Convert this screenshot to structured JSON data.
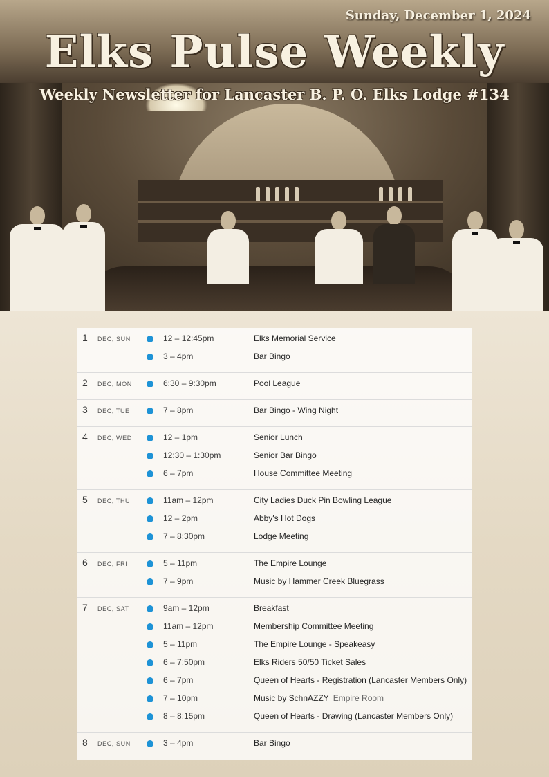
{
  "header": {
    "date": "Sunday, December 1, 2024",
    "title": "Elks Pulse Weekly",
    "subtitle": "Weekly Newsletter for Lancaster B. P. O. Elks Lodge #134"
  },
  "colors": {
    "event_dot": "#1e93d6"
  },
  "days": [
    {
      "num": "1",
      "label": "DEC, SUN",
      "events": [
        {
          "time": "12 – 12:45pm",
          "title": "Elks Memorial Service"
        },
        {
          "time": "3 – 4pm",
          "title": "Bar Bingo"
        }
      ]
    },
    {
      "num": "2",
      "label": "DEC, MON",
      "events": [
        {
          "time": "6:30 – 9:30pm",
          "title": "Pool League"
        }
      ]
    },
    {
      "num": "3",
      "label": "DEC, TUE",
      "events": [
        {
          "time": "7 – 8pm",
          "title": "Bar Bingo - Wing Night"
        }
      ]
    },
    {
      "num": "4",
      "label": "DEC, WED",
      "events": [
        {
          "time": "12 – 1pm",
          "title": "Senior Lunch"
        },
        {
          "time": "12:30 – 1:30pm",
          "title": "Senior Bar Bingo"
        },
        {
          "time": "6 – 7pm",
          "title": "House Committee Meeting"
        }
      ]
    },
    {
      "num": "5",
      "label": "DEC, THU",
      "events": [
        {
          "time": "11am – 12pm",
          "title": "City Ladies Duck Pin Bowling League"
        },
        {
          "time": "12 – 2pm",
          "title": "Abby's Hot Dogs"
        },
        {
          "time": "7 – 8:30pm",
          "title": "Lodge Meeting"
        }
      ]
    },
    {
      "num": "6",
      "label": "DEC, FRI",
      "events": [
        {
          "time": "5 – 11pm",
          "title": "The Empire Lounge"
        },
        {
          "time": "7 – 9pm",
          "title": "Music by Hammer Creek Bluegrass"
        }
      ]
    },
    {
      "num": "7",
      "label": "DEC, SAT",
      "events": [
        {
          "time": "9am – 12pm",
          "title": "Breakfast"
        },
        {
          "time": "11am – 12pm",
          "title": "Membership Committee Meeting"
        },
        {
          "time": "5 – 11pm",
          "title": "The Empire Lounge - Speakeasy"
        },
        {
          "time": "6 – 7:50pm",
          "title": "Elks Riders 50/50 Ticket Sales"
        },
        {
          "time": "6 – 7pm",
          "title": "Queen of Hearts - Registration (Lancaster Members Only)"
        },
        {
          "time": "7 – 10pm",
          "title": "Music by SchnAZZY",
          "location": "Empire Room"
        },
        {
          "time": "8 – 8:15pm",
          "title": "Queen of Hearts - Drawing (Lancaster Members Only)"
        }
      ]
    },
    {
      "num": "8",
      "label": "DEC, SUN",
      "events": [
        {
          "time": "3 – 4pm",
          "title": "Bar Bingo"
        }
      ]
    }
  ]
}
